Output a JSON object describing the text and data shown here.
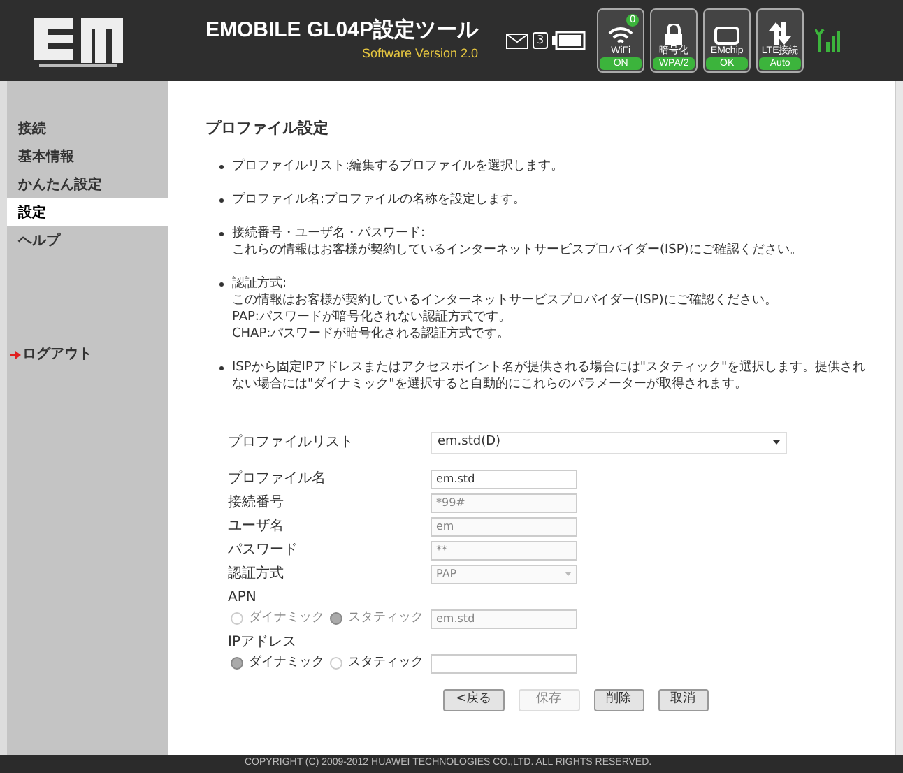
{
  "header": {
    "title": "EMOBILE GL04P設定ツール",
    "version": "Software Version 2.0",
    "mail_count": "3",
    "wifi_clients": "0",
    "status": [
      {
        "kind": "wifi",
        "label": "WiFi",
        "value": "ON"
      },
      {
        "kind": "lock",
        "label": "暗号化",
        "value": "WPA/2"
      },
      {
        "kind": "chip",
        "label": "EMchip",
        "value": "OK"
      },
      {
        "kind": "lte",
        "label": "LTE接続",
        "value": "Auto"
      }
    ]
  },
  "sidebar": {
    "items": [
      {
        "label": "接続",
        "selected": false
      },
      {
        "label": "基本情報",
        "selected": false
      },
      {
        "label": "かんたん設定",
        "selected": false
      },
      {
        "label": "設定",
        "selected": true
      },
      {
        "label": "ヘルプ",
        "selected": false
      }
    ],
    "logout": "ログアウト"
  },
  "main": {
    "title": "プロファイル設定",
    "bullets": [
      [
        "プロファイルリスト:編集するプロファイルを選択します。"
      ],
      [
        "プロファイル名:プロファイルの名称を設定します。"
      ],
      [
        "接続番号・ユーザ名・パスワード:",
        "これらの情報はお客様が契約しているインターネットサービスプロバイダー(ISP)にご確認ください。"
      ],
      [
        "認証方式:",
        "この情報はお客様が契約しているインターネットサービスプロバイダー(ISP)にご確認ください。",
        "PAP:パスワードが暗号化されない認証方式です。",
        "CHAP:パスワードが暗号化される認証方式です。"
      ],
      [
        "ISPから固定IPアドレスまたはアクセスポイント名が提供される場合には\"スタティック\"を選択します。提供されない場合には\"ダイナミック\"を選択すると自動的にこれらのパラメーターが取得されます。"
      ]
    ],
    "profile_list": {
      "label": "プロファイルリスト",
      "value": "em.std(D)"
    },
    "fields": [
      {
        "kind": "text",
        "label": "プロファイル名",
        "value": "em.std",
        "disabled": false
      },
      {
        "kind": "text",
        "label": "接続番号",
        "value": "*99#",
        "disabled": true
      },
      {
        "kind": "text",
        "label": "ユーザ名",
        "value": "em",
        "disabled": true
      },
      {
        "kind": "text",
        "label": "パスワード",
        "value": "**",
        "disabled": true
      },
      {
        "kind": "select",
        "label": "認証方式",
        "value": "PAP",
        "disabled": true
      }
    ],
    "apn": {
      "label": "APN",
      "options": [
        {
          "label": "ダイナミック",
          "selected": false
        },
        {
          "label": "スタティック",
          "selected": true
        }
      ],
      "value": "em.std",
      "disabled": true
    },
    "ip": {
      "label": "IPアドレス",
      "options": [
        {
          "label": "ダイナミック",
          "selected": true
        },
        {
          "label": "スタティック",
          "selected": false
        }
      ]
    },
    "buttons": [
      {
        "label": "<戻る",
        "disabled": false
      },
      {
        "label": "保存",
        "disabled": true
      },
      {
        "label": "削除",
        "disabled": false
      },
      {
        "label": "取消",
        "disabled": false
      }
    ]
  },
  "footer": "COPYRIGHT (C) 2009-2012 HUAWEI TECHNOLOGIES CO.,LTD. ALL RIGHTS RESERVED."
}
